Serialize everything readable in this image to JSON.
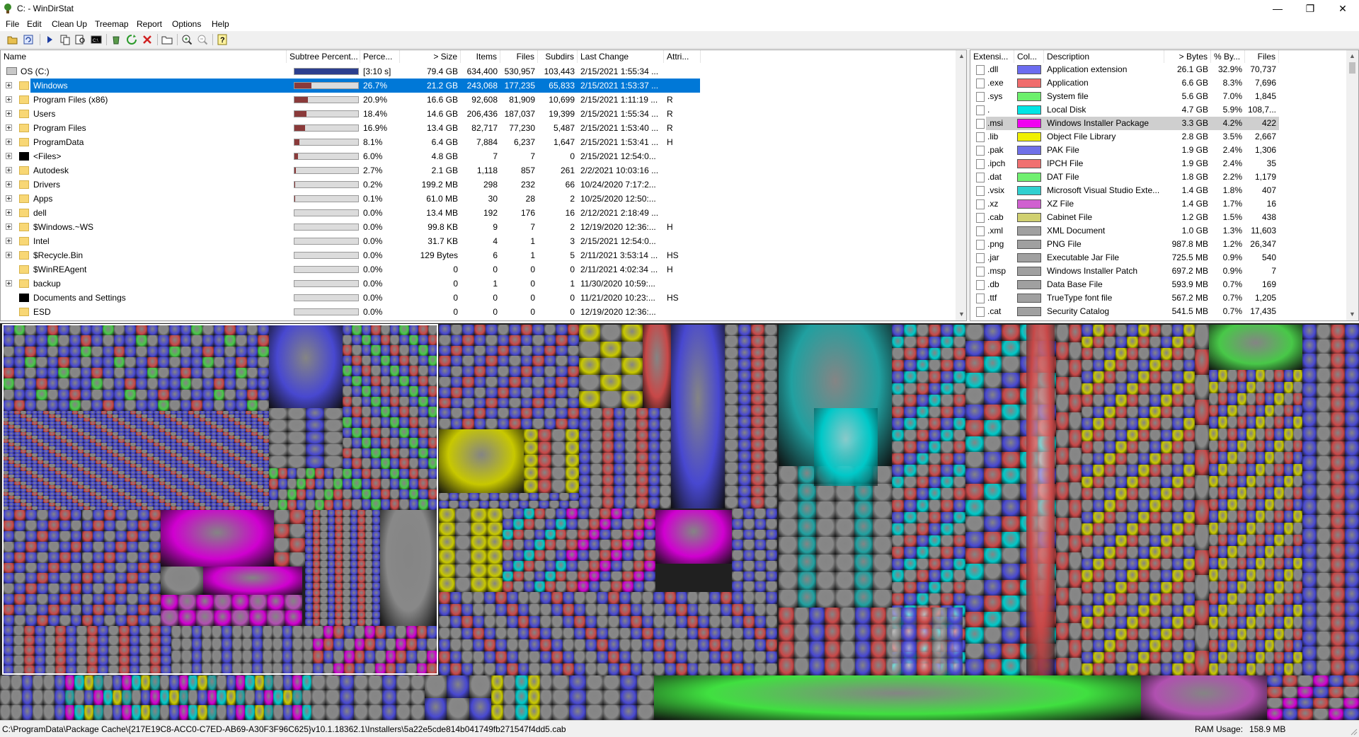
{
  "window": {
    "title": "C: - WinDirStat"
  },
  "menu": [
    "File",
    "Edit",
    "Clean Up",
    "Treemap",
    "Report",
    "Options",
    "Help"
  ],
  "toolbar_icons": [
    "open-icon",
    "refresh-icon",
    "play-icon",
    "copy-icon",
    "find-icon",
    "command-prompt-icon",
    "recycle-icon",
    "delete-icon",
    "folder-icon",
    "zoom-in-icon",
    "zoom-out-icon",
    "help-icon"
  ],
  "dir_tree": {
    "columns": [
      "Name",
      "Subtree Percent...",
      "Perce...",
      "> Size",
      "Items",
      "Files",
      "Subdirs",
      "Last Change",
      "Attri..."
    ],
    "rows": [
      {
        "name": "OS (C:)",
        "bar": 100,
        "pct": "[3:10 s]",
        "size": "79.4 GB",
        "items": "634,400",
        "files": "530,957",
        "subdirs": "103,443",
        "last": "2/15/2021  1:55:34 ...",
        "attr": "",
        "icon": "drive"
      },
      {
        "name": "Windows",
        "bar": 26.7,
        "pct": "26.7%",
        "size": "21.2 GB",
        "items": "243,068",
        "files": "177,235",
        "subdirs": "65,833",
        "last": "2/15/2021  1:53:37 ...",
        "attr": "",
        "icon": "folder",
        "selected": true
      },
      {
        "name": "Program Files (x86)",
        "bar": 20.9,
        "pct": "20.9%",
        "size": "16.6 GB",
        "items": "92,608",
        "files": "81,909",
        "subdirs": "10,699",
        "last": "2/15/2021  1:11:19 ...",
        "attr": "R",
        "icon": "folder"
      },
      {
        "name": "Users",
        "bar": 18.4,
        "pct": "18.4%",
        "size": "14.6 GB",
        "items": "206,436",
        "files": "187,037",
        "subdirs": "19,399",
        "last": "2/15/2021  1:55:34 ...",
        "attr": "R",
        "icon": "folder"
      },
      {
        "name": "Program Files",
        "bar": 16.9,
        "pct": "16.9%",
        "size": "13.4 GB",
        "items": "82,717",
        "files": "77,230",
        "subdirs": "5,487",
        "last": "2/15/2021  1:53:40 ...",
        "attr": "R",
        "icon": "folder"
      },
      {
        "name": "ProgramData",
        "bar": 8.1,
        "pct": "8.1%",
        "size": "6.4 GB",
        "items": "7,884",
        "files": "6,237",
        "subdirs": "1,647",
        "last": "2/15/2021  1:53:41 ...",
        "attr": "H",
        "icon": "folder"
      },
      {
        "name": "<Files>",
        "bar": 6.0,
        "pct": "6.0%",
        "size": "4.8 GB",
        "items": "7",
        "files": "7",
        "subdirs": "0",
        "last": "2/15/2021  12:54:0...",
        "attr": "",
        "icon": "black"
      },
      {
        "name": "Autodesk",
        "bar": 2.7,
        "pct": "2.7%",
        "size": "2.1 GB",
        "items": "1,118",
        "files": "857",
        "subdirs": "261",
        "last": "2/2/2021  10:03:16 ...",
        "attr": "",
        "icon": "folder"
      },
      {
        "name": "Drivers",
        "bar": 0.2,
        "pct": "0.2%",
        "size": "199.2 MB",
        "items": "298",
        "files": "232",
        "subdirs": "66",
        "last": "10/24/2020  7:17:2...",
        "attr": "",
        "icon": "folder"
      },
      {
        "name": "Apps",
        "bar": 0.1,
        "pct": "0.1%",
        "size": "61.0 MB",
        "items": "30",
        "files": "28",
        "subdirs": "2",
        "last": "10/25/2020  12:50:...",
        "attr": "",
        "icon": "folder"
      },
      {
        "name": "dell",
        "bar": 0,
        "pct": "0.0%",
        "size": "13.4 MB",
        "items": "192",
        "files": "176",
        "subdirs": "16",
        "last": "2/12/2021  2:18:49 ...",
        "attr": "",
        "icon": "folder"
      },
      {
        "name": "$Windows.~WS",
        "bar": 0,
        "pct": "0.0%",
        "size": "99.8 KB",
        "items": "9",
        "files": "7",
        "subdirs": "2",
        "last": "12/19/2020  12:36:...",
        "attr": "H",
        "icon": "folder"
      },
      {
        "name": "Intel",
        "bar": 0,
        "pct": "0.0%",
        "size": "31.7 KB",
        "items": "4",
        "files": "1",
        "subdirs": "3",
        "last": "2/15/2021  12:54:0...",
        "attr": "",
        "icon": "folder"
      },
      {
        "name": "$Recycle.Bin",
        "bar": 0,
        "pct": "0.0%",
        "size": "129 Bytes",
        "items": "6",
        "files": "1",
        "subdirs": "5",
        "last": "2/11/2021  3:53:14 ...",
        "attr": "HS",
        "icon": "folder"
      },
      {
        "name": "$WinREAgent",
        "bar": 0,
        "pct": "0.0%",
        "size": "0",
        "items": "0",
        "files": "0",
        "subdirs": "0",
        "last": "2/11/2021  4:02:34 ...",
        "attr": "H",
        "icon": "folder",
        "noexpand": true
      },
      {
        "name": "backup",
        "bar": 0,
        "pct": "0.0%",
        "size": "0",
        "items": "1",
        "files": "0",
        "subdirs": "1",
        "last": "11/30/2020  10:59:...",
        "attr": "",
        "icon": "folder"
      },
      {
        "name": "Documents and Settings",
        "bar": 0,
        "pct": "0.0%",
        "size": "0",
        "items": "0",
        "files": "0",
        "subdirs": "0",
        "last": "11/21/2020  10:23:...",
        "attr": "HS",
        "icon": "black",
        "noexpand": true
      },
      {
        "name": "ESD",
        "bar": 0,
        "pct": "0.0%",
        "size": "0",
        "items": "0",
        "files": "0",
        "subdirs": "0",
        "last": "12/19/2020  12:36:...",
        "attr": "",
        "icon": "folder",
        "noexpand": true
      }
    ]
  },
  "ext_list": {
    "columns": [
      "Extensi...",
      "Col...",
      "Description",
      "> Bytes",
      "% By...",
      "Files"
    ],
    "rows": [
      {
        "ext": ".dll",
        "color": "#6c6cf0",
        "desc": "Application extension",
        "bytes": "26.1 GB",
        "pct": "32.9%",
        "files": "70,737"
      },
      {
        "ext": ".exe",
        "color": "#f06c6c",
        "desc": "Application",
        "bytes": "6.6 GB",
        "pct": "8.3%",
        "files": "7,696"
      },
      {
        "ext": ".sys",
        "color": "#6cf06c",
        "desc": "System file",
        "bytes": "5.6 GB",
        "pct": "7.0%",
        "files": "1,845"
      },
      {
        "ext": ".",
        "color": "#00e5e5",
        "desc": "Local Disk",
        "bytes": "4.7 GB",
        "pct": "5.9%",
        "files": "108,7..."
      },
      {
        "ext": ".msi",
        "color": "#f000f0",
        "desc": "Windows Installer Package",
        "bytes": "3.3 GB",
        "pct": "4.2%",
        "files": "422",
        "highlight": true
      },
      {
        "ext": ".lib",
        "color": "#f0f000",
        "desc": "Object File Library",
        "bytes": "2.8 GB",
        "pct": "3.5%",
        "files": "2,667"
      },
      {
        "ext": ".pak",
        "color": "#7070e8",
        "desc": "PAK File",
        "bytes": "1.9 GB",
        "pct": "2.4%",
        "files": "1,306"
      },
      {
        "ext": ".ipch",
        "color": "#f07070",
        "desc": "IPCH File",
        "bytes": "1.9 GB",
        "pct": "2.4%",
        "files": "35"
      },
      {
        "ext": ".dat",
        "color": "#70f070",
        "desc": "DAT File",
        "bytes": "1.8 GB",
        "pct": "2.2%",
        "files": "1,179"
      },
      {
        "ext": ".vsix",
        "color": "#30d0d0",
        "desc": "Microsoft Visual Studio Exte...",
        "bytes": "1.4 GB",
        "pct": "1.8%",
        "files": "407"
      },
      {
        "ext": ".xz",
        "color": "#d060d0",
        "desc": "XZ File",
        "bytes": "1.4 GB",
        "pct": "1.7%",
        "files": "16"
      },
      {
        "ext": ".cab",
        "color": "#d0d070",
        "desc": "Cabinet File",
        "bytes": "1.2 GB",
        "pct": "1.5%",
        "files": "438"
      },
      {
        "ext": ".xml",
        "color": "#a0a0a0",
        "desc": "XML Document",
        "bytes": "1.0 GB",
        "pct": "1.3%",
        "files": "11,603"
      },
      {
        "ext": ".png",
        "color": "#a0a0a0",
        "desc": "PNG File",
        "bytes": "987.8 MB",
        "pct": "1.2%",
        "files": "26,347"
      },
      {
        "ext": ".jar",
        "color": "#a0a0a0",
        "desc": "Executable Jar File",
        "bytes": "725.5 MB",
        "pct": "0.9%",
        "files": "540"
      },
      {
        "ext": ".msp",
        "color": "#a0a0a0",
        "desc": "Windows Installer Patch",
        "bytes": "697.2 MB",
        "pct": "0.9%",
        "files": "7"
      },
      {
        "ext": ".db",
        "color": "#a0a0a0",
        "desc": "Data Base File",
        "bytes": "593.9 MB",
        "pct": "0.7%",
        "files": "169"
      },
      {
        "ext": ".ttf",
        "color": "#a0a0a0",
        "desc": "TrueType font file",
        "bytes": "567.2 MB",
        "pct": "0.7%",
        "files": "1,205"
      },
      {
        "ext": ".cat",
        "color": "#a0a0a0",
        "desc": "Security Catalog",
        "bytes": "541.5 MB",
        "pct": "0.7%",
        "files": "17,435"
      }
    ]
  },
  "status": {
    "path": "C:\\ProgramData\\Package Cache\\{217E19C8-ACC0-C7ED-AB69-A30F3F96C625}v10.1.18362.1\\Installers\\5a22e5cde814b041749fb271547f4dd5.cab",
    "ram_label": "RAM Usage:",
    "ram_value": "158.9 MB"
  },
  "treemap_colors": {
    "blue": "#4848d0",
    "red": "#c84848",
    "green": "#48c848",
    "cyan": "#00c8c8",
    "magenta": "#d000d0",
    "yellow": "#c8c800",
    "gray": "#888888",
    "teal": "#20a0a0",
    "lime": "#40e040",
    "pink": "#b050b0"
  }
}
